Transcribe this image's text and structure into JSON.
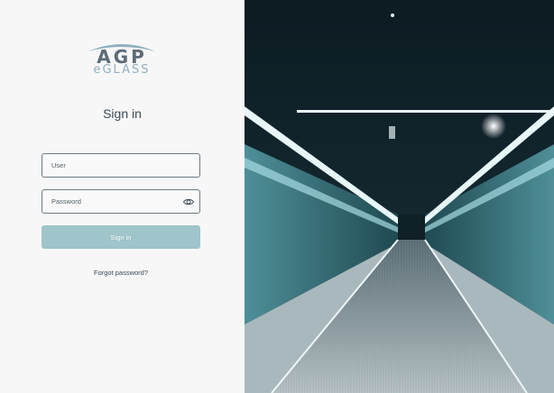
{
  "logo": {
    "brand": "AGP",
    "product": "eGLASS"
  },
  "login": {
    "title": "Sign in",
    "user_placeholder": "User",
    "password_placeholder": "Password",
    "submit_label": "Sign in",
    "forgot_label": "Forgot password?"
  },
  "colors": {
    "button": "#9fc4c9",
    "accent": "#8fb0bf",
    "text": "#3d4b55"
  },
  "icons": {
    "password_toggle": "eye-icon"
  }
}
